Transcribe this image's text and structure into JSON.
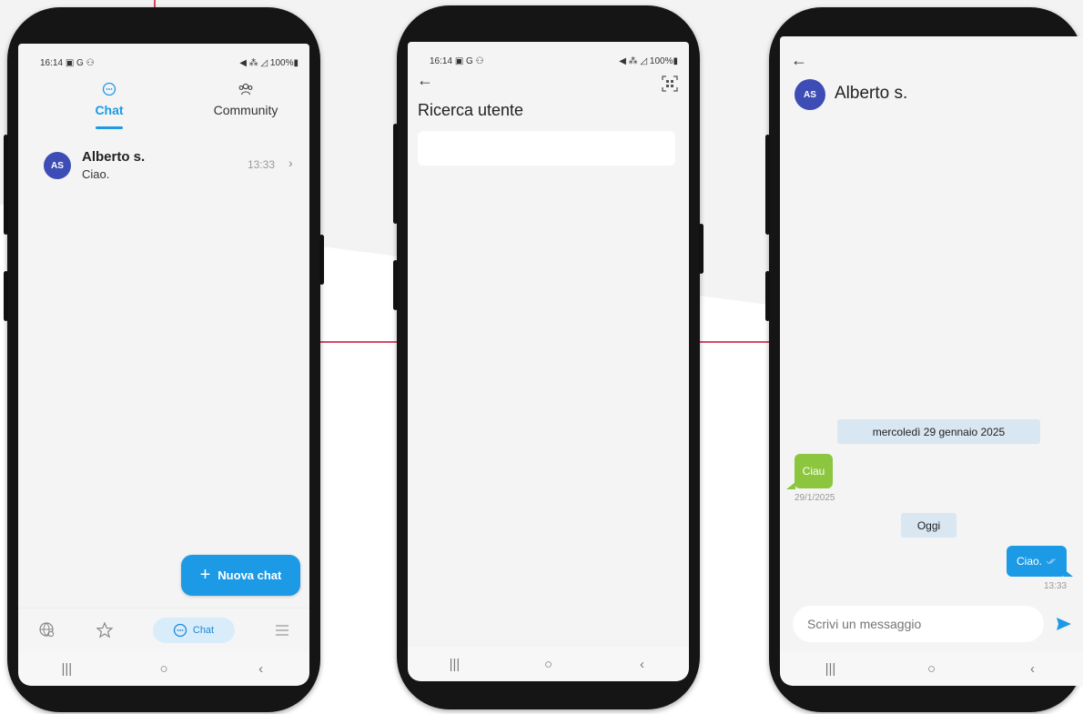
{
  "status_bar": {
    "time": "16:14",
    "notification_icons": "▣ G ⚇",
    "right": "◀ ⁂ ◿ 100%▮"
  },
  "screen1": {
    "tabs": [
      {
        "label": "Chat",
        "icon": "chat-bubble-icon",
        "active": true
      },
      {
        "label": "Community",
        "icon": "people-icon",
        "active": false
      }
    ],
    "chats": [
      {
        "initials": "AS",
        "name": "Alberto s.",
        "preview": "Ciao.",
        "time": "13:33"
      }
    ],
    "fab_label": "Nuova chat",
    "bottom_nav": [
      {
        "icon": "globe-search-icon"
      },
      {
        "icon": "star-icon"
      },
      {
        "icon": "chat-bubble-icon",
        "label": "Chat",
        "active": true
      },
      {
        "icon": "menu-icon"
      }
    ]
  },
  "screen2": {
    "title": "Ricerca utente",
    "search_value": "",
    "search_placeholder": ""
  },
  "screen3": {
    "contact_initials": "AS",
    "contact_name": "Alberto s.",
    "messages": [
      {
        "type": "date",
        "text": "mercoledì 29 gennaio 2025"
      },
      {
        "type": "in",
        "text": "Ciau",
        "meta": "29/1/2025"
      },
      {
        "type": "date",
        "text": "Oggi"
      },
      {
        "type": "out",
        "text": "Ciao.",
        "meta": "13:33"
      }
    ],
    "composer_placeholder": "Scrivi un messaggio"
  },
  "colors": {
    "accent": "#1c9ae6",
    "avatar": "#3d4db5",
    "incoming": "#8cc63f",
    "date_chip": "#d8e7f2",
    "connector": "#c8102e"
  }
}
